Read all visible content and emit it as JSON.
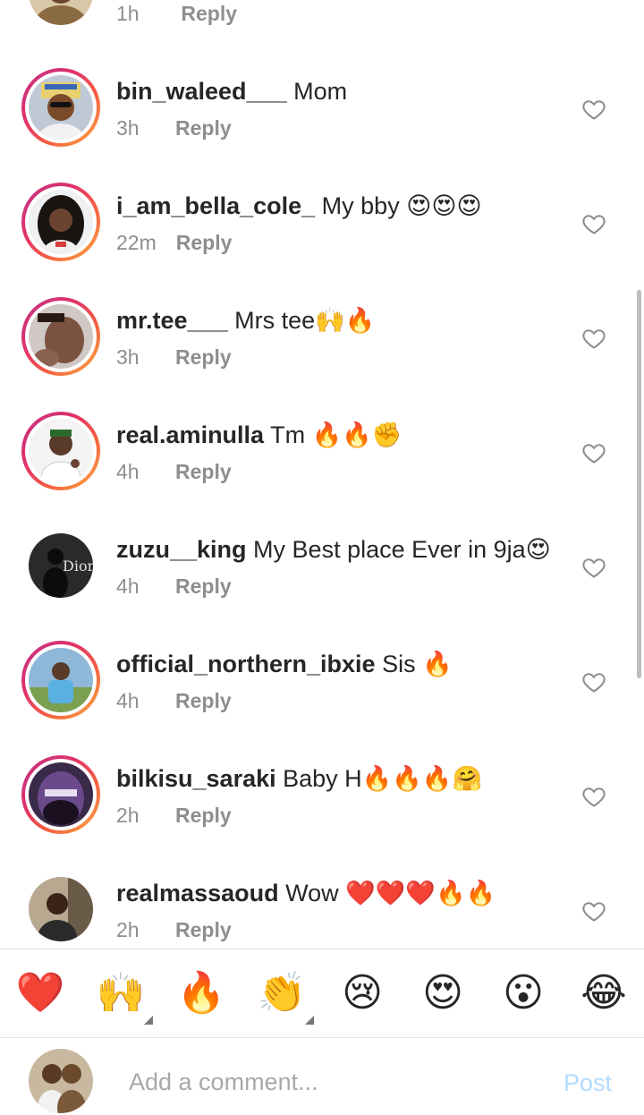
{
  "top_partial": {
    "time": "1h",
    "reply": "Reply"
  },
  "comments": [
    {
      "username": "bin_waleed___",
      "text": "Mom",
      "time": "3h",
      "reply": "Reply"
    },
    {
      "username": "i_am_bella_cole_",
      "text": "My bby 😍😍😍",
      "time": "22m",
      "reply": "Reply"
    },
    {
      "username": "mr.tee___",
      "text": "Mrs tee🙌🔥",
      "time": "3h",
      "reply": "Reply"
    },
    {
      "username": "real.aminulla",
      "text": "Tm 🔥🔥✊",
      "time": "4h",
      "reply": "Reply"
    },
    {
      "username": "zuzu__king",
      "text": "My Best place Ever in 9ja😍",
      "time": "4h",
      "reply": "Reply"
    },
    {
      "username": "official_northern_ibxie",
      "text": "Sis 🔥",
      "time": "4h",
      "reply": "Reply"
    },
    {
      "username": "bilkisu_saraki",
      "text": "Baby H🔥🔥🔥🤗",
      "time": "2h",
      "reply": "Reply"
    },
    {
      "username": "realmassaoud",
      "text": "Wow ❤️❤️❤️🔥🔥",
      "time": "2h",
      "reply": "Reply"
    }
  ],
  "reactions": [
    "❤️",
    "🙌",
    "🔥",
    "👏",
    "😢",
    "😍",
    "😮",
    "😂"
  ],
  "composer": {
    "placeholder": "Add a comment...",
    "post_label": "Post"
  },
  "colors": {
    "link_blue_disabled": "#b3dbff",
    "meta_grey": "#8e8e8e"
  }
}
